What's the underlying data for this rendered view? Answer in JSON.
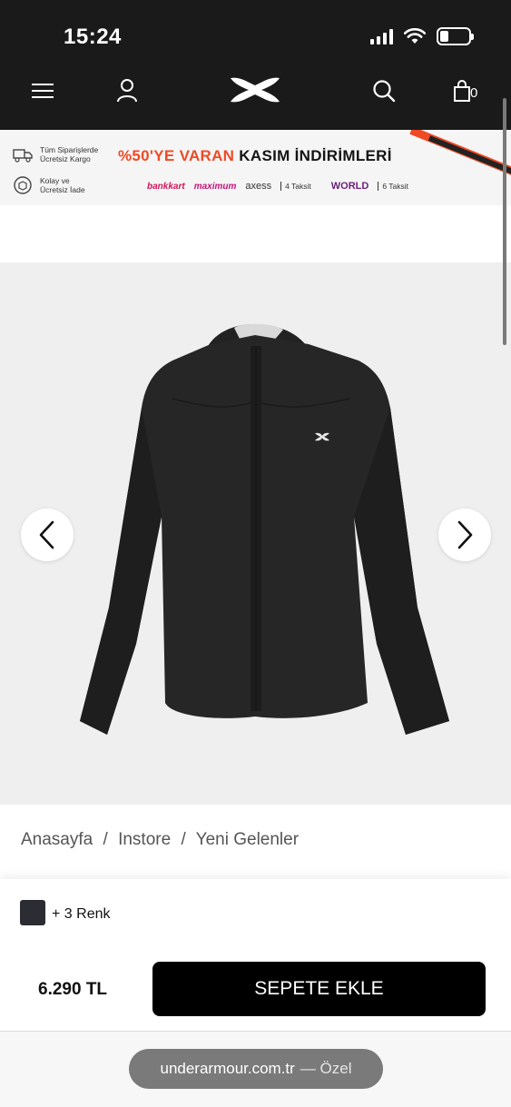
{
  "status_bar": {
    "time": "15:24"
  },
  "nav": {
    "menu_icon": "hamburger-menu-icon",
    "account_icon": "user-icon",
    "logo_icon": "under-armour-logo-icon",
    "search_icon": "search-icon",
    "cart_icon": "shopping-bag-icon",
    "cart_count": "0"
  },
  "banner": {
    "shipping_text": "Tüm Siparişlerde\nÜcretsiz Kargo",
    "return_text": "Kolay ve\nÜcretsiz İade",
    "headline_orange": "%50'YE VARAN",
    "headline_black": "KASIM İNDİRİMLERİ",
    "bankkart": "bankkart",
    "maximum": "maximum",
    "axess": "axess",
    "axess_installments": "4 Taksit",
    "world": "WORLD",
    "world_installments": "6 Taksit",
    "accent_color": "#ef4a25"
  },
  "product": {
    "prev_icon": "chevron-left-icon",
    "next_icon": "chevron-right-icon",
    "image_alt": "black-rain-jacket-image"
  },
  "breadcrumb": {
    "items": [
      "Anasayfa",
      "Instore",
      "Yeni Gelenler"
    ],
    "separator": "/"
  },
  "purchase": {
    "swatch_color": "#2b2d33",
    "color_count_label": "+ 3 Renk",
    "price": "6.290 TL",
    "add_to_cart_label": "SEPETE EKLE"
  },
  "browser": {
    "domain": "underarmour.com.tr",
    "mode": "— Özel"
  }
}
